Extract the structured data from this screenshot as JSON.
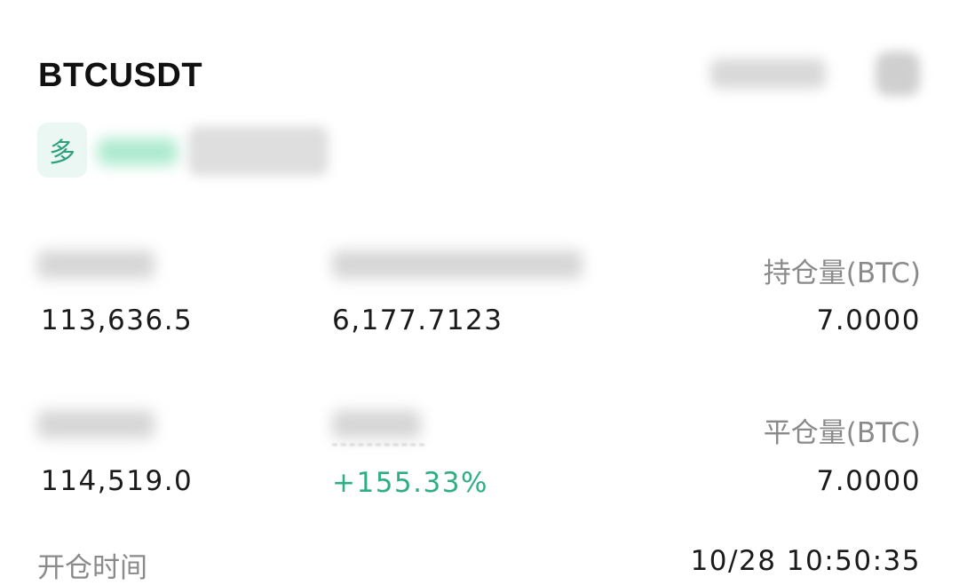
{
  "header": {
    "symbol": "BTCUSDT",
    "side_label": "多"
  },
  "stats": {
    "row1": {
      "col1_value": "113,636.5",
      "col2_value": "6,177.7123",
      "col3_label": "持仓量(BTC)",
      "col3_value": "7.0000"
    },
    "row2": {
      "col1_value": "114,519.0",
      "col2_value": "+155.33%",
      "col3_label": "平仓量(BTC)",
      "col3_value": "7.0000"
    },
    "open_time": {
      "label": "开仓时间",
      "value": "10/28 10:50:35"
    }
  },
  "colors": {
    "profit": "#2fae86",
    "badge_bg": "#eaf7f2",
    "badge_text": "#2ea07d"
  },
  "icons": {
    "header_right": "share-icon"
  }
}
